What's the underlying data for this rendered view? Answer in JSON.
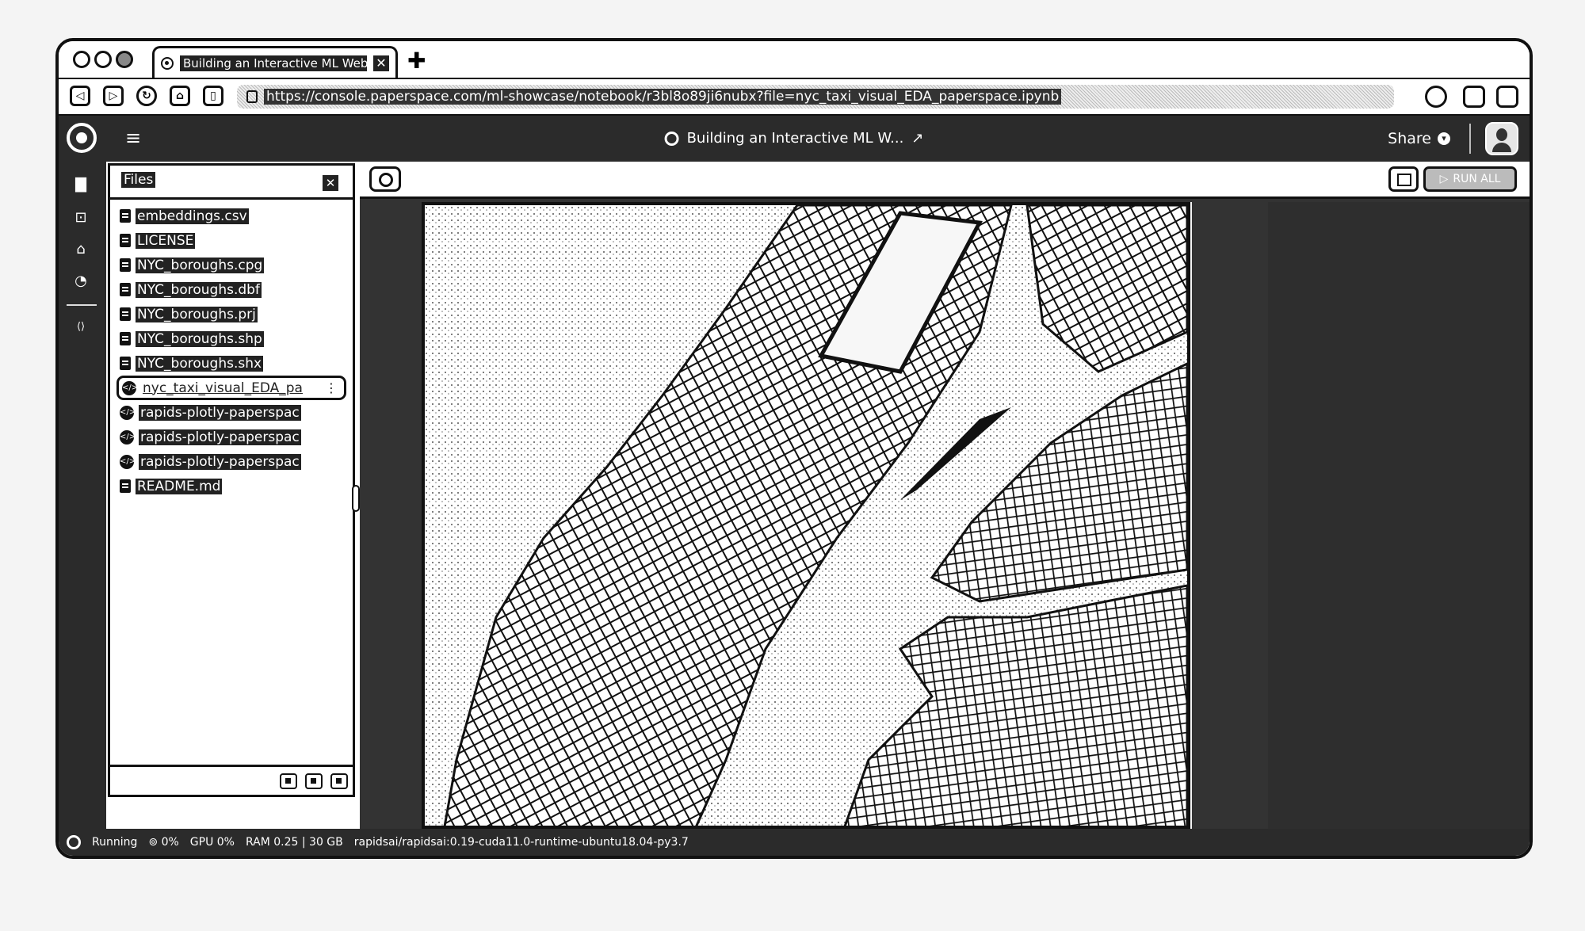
{
  "browser": {
    "tab_title": "Building an Interactive ML Web",
    "tab_close": "✕",
    "new_tab": "✚",
    "url": "https://console.paperspace.com/ml-showcase/notebook/r3bl8o89ji6nubx?file=nyc_taxi_visual_EDA_paperspace.ipynb"
  },
  "header": {
    "menu": "≡",
    "notebook_title": "Building an Interactive ML W...",
    "edit_icon": "↗",
    "share_label": "Share",
    "share_chevron": "▾"
  },
  "rail": {
    "icons": [
      "▇",
      "⊡",
      "⌂",
      "◔",
      "⟨⟩"
    ]
  },
  "files": {
    "title": "Files",
    "close": "✕",
    "items": [
      {
        "name": "embeddings.csv",
        "type": "file",
        "selected": false
      },
      {
        "name": "LICENSE",
        "type": "file",
        "selected": false
      },
      {
        "name": "NYC_boroughs.cpg",
        "type": "file",
        "selected": false
      },
      {
        "name": "NYC_boroughs.dbf",
        "type": "file",
        "selected": false
      },
      {
        "name": "NYC_boroughs.prj",
        "type": "file",
        "selected": false
      },
      {
        "name": "NYC_boroughs.shp",
        "type": "file",
        "selected": false
      },
      {
        "name": "NYC_boroughs.shx",
        "type": "file",
        "selected": false
      },
      {
        "name": "nyc_taxi_visual_EDA_pa",
        "type": "code",
        "selected": true
      },
      {
        "name": "rapids-plotly-paperspac",
        "type": "code",
        "selected": false
      },
      {
        "name": "rapids-plotly-paperspac",
        "type": "code",
        "selected": false
      },
      {
        "name": "rapids-plotly-paperspac",
        "type": "code",
        "selected": false
      },
      {
        "name": "README.md",
        "type": "file",
        "selected": false
      }
    ],
    "item_menu": "⋮"
  },
  "toolbar": {
    "run_label": "RUN ALL"
  },
  "status": {
    "state": "Running",
    "cpu": "0%",
    "gpu": "GPU 0%",
    "ram": "RAM 0.25 | 30 GB",
    "image": "rapidsai/rapidsai:0.19-cuda11.0-runtime-ubuntu18.04-py3.7"
  }
}
